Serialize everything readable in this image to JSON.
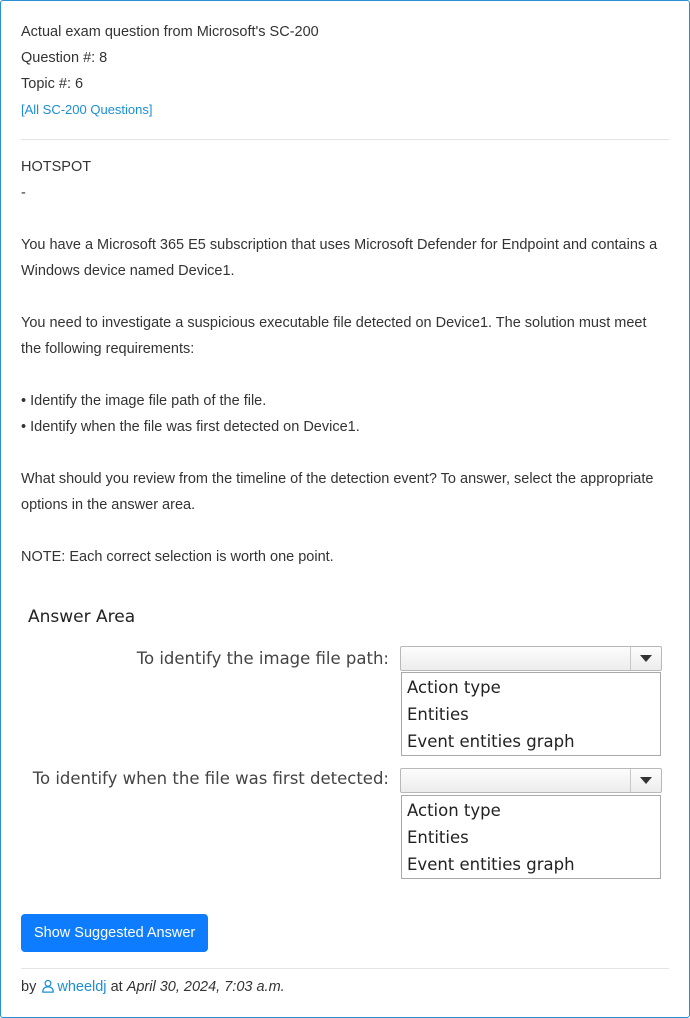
{
  "header": {
    "title": "Actual exam question from Microsoft's SC-200",
    "question_number": "Question #: 8",
    "topic": "Topic #: 6",
    "all_questions_link": "[All SC-200 Questions]"
  },
  "question": {
    "type": "HOTSPOT",
    "dash": "-",
    "paragraph1": "You have a Microsoft 365 E5 subscription that uses Microsoft Defender for Endpoint and contains a Windows device named Device1.",
    "paragraph2": "You need to investigate a suspicious executable file detected on Device1. The solution must meet the following requirements:",
    "bullets": [
      "• Identify the image file path of the file.",
      "• Identify when the file was first detected on Device1."
    ],
    "paragraph3": "What should you review from the timeline of the detection event? To answer, select the appropriate options in the answer area.",
    "note": "NOTE: Each correct selection is worth one point."
  },
  "answer_area": {
    "title": "Answer Area",
    "items": [
      {
        "prompt": "To identify the image file path:",
        "selected": "",
        "options": [
          "Action type",
          "Entities",
          "Event entities graph"
        ]
      },
      {
        "prompt": "To identify when the file was first detected:",
        "selected": "",
        "options": [
          "Action type",
          "Entities",
          "Event entities graph"
        ]
      }
    ]
  },
  "actions": {
    "show_answer_label": "Show Suggested Answer"
  },
  "footer": {
    "by": "by",
    "username": "wheeldj",
    "at": "at",
    "date": "April 30, 2024, 7:03 a.m."
  },
  "colors": {
    "border": "#2a8fd0",
    "link": "#1a8fd6",
    "button": "#0d7cff"
  }
}
